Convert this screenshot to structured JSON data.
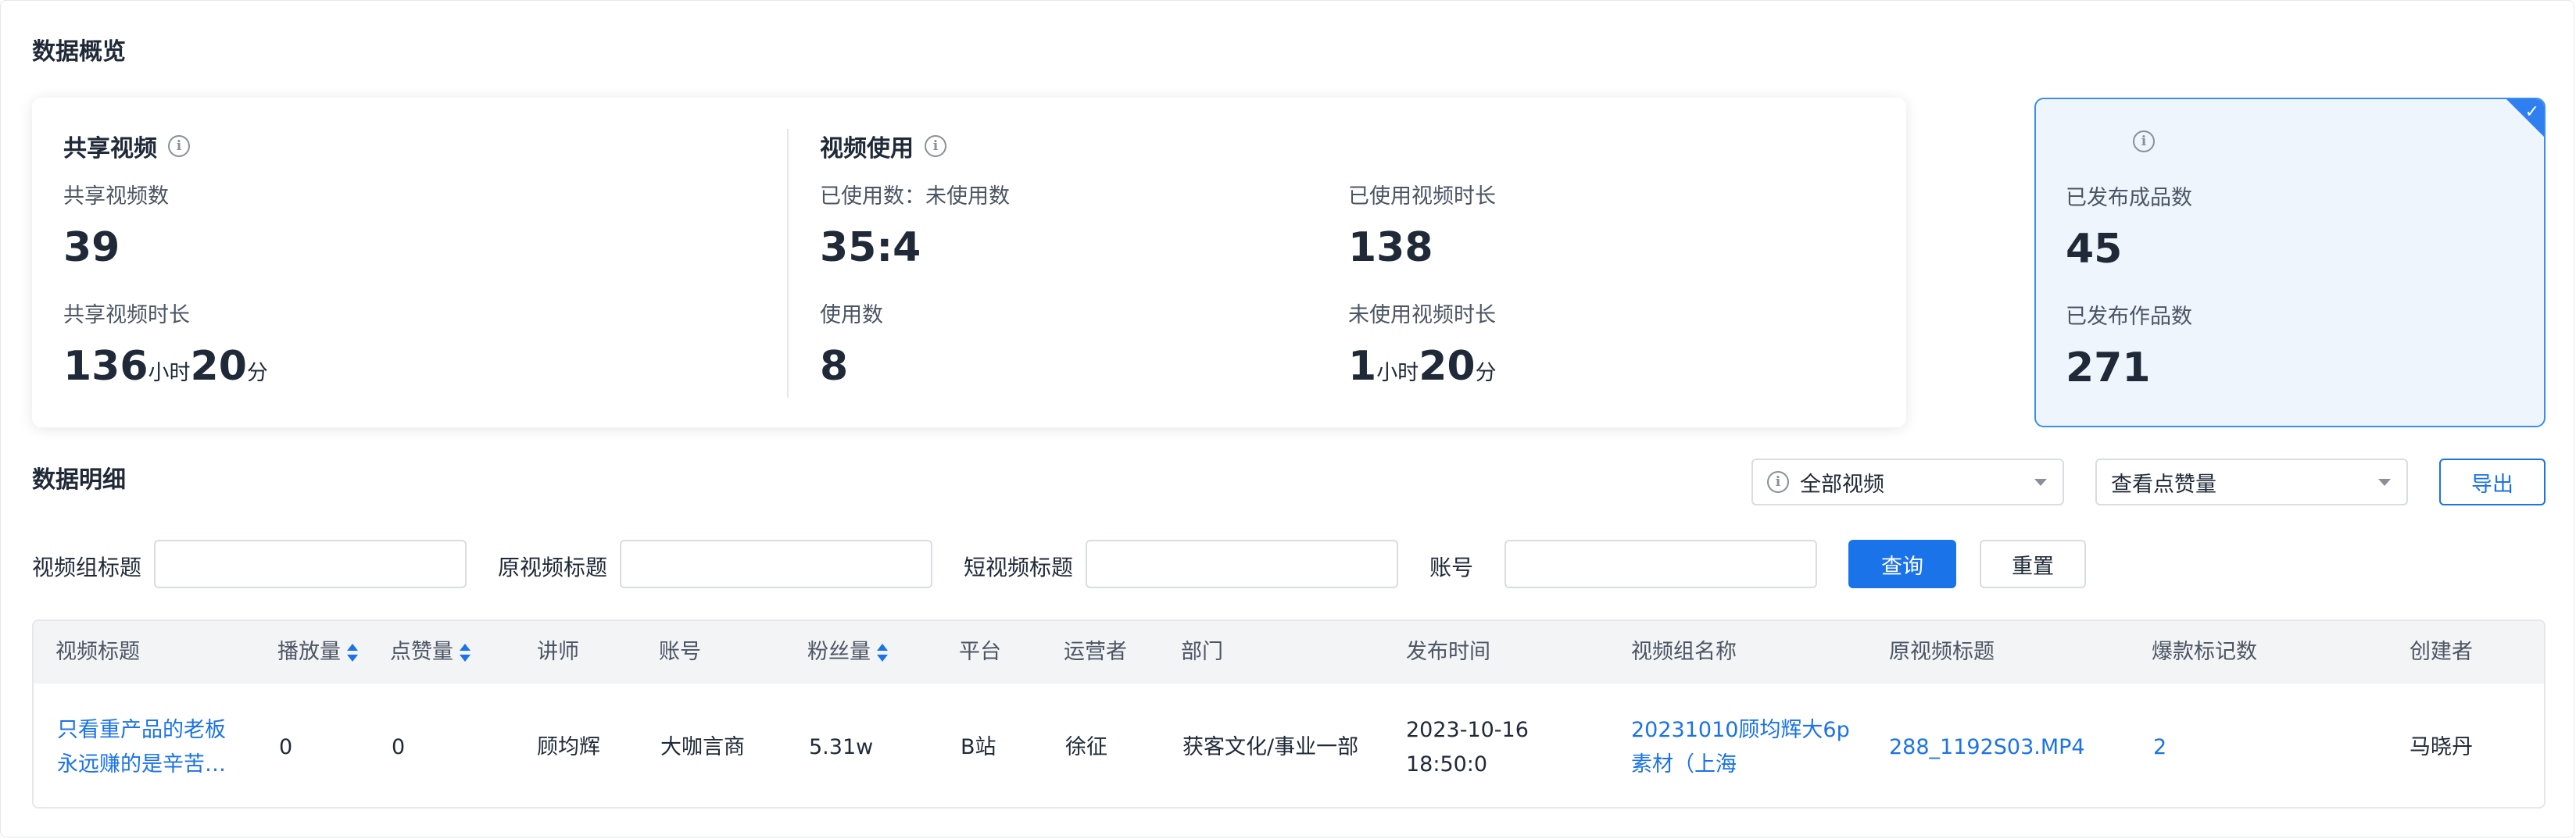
{
  "overview": {
    "title": "数据概览",
    "shared": {
      "title": "共享视频",
      "count_label": "共享视频数",
      "count_value": "39",
      "duration_label": "共享视频时长",
      "duration_hours": "136",
      "hours_unit": "小时",
      "duration_minutes": "20",
      "minutes_unit": "分"
    },
    "usage": {
      "title": "视频使用",
      "ratio_label": "已使用数：未使用数",
      "ratio_value": "35:4",
      "used_count_label": "使用数",
      "used_count_value": "8",
      "used_duration_label": "已使用视频时长",
      "used_duration_value": "138",
      "unused_duration_label": "未使用视频时长",
      "unused_hours": "1",
      "hours_unit": "小时",
      "unused_minutes": "20",
      "minutes_unit": "分"
    },
    "published": {
      "title": "",
      "finished_label": "已发布成品数",
      "finished_value": "45",
      "works_label": "已发布作品数",
      "works_value": "271"
    }
  },
  "detail": {
    "title": "数据明细",
    "video_filter": "全部视频",
    "metric_select": "查看点赞量",
    "export_label": "导出",
    "filters": {
      "group_title_label": "视频组标题",
      "original_title_label": "原视频标题",
      "short_title_label": "短视频标题",
      "account_label": "账号",
      "query_label": "查询",
      "reset_label": "重置"
    },
    "columns": [
      "视频标题",
      "播放量",
      "点赞量",
      "讲师",
      "账号",
      "粉丝量",
      "平台",
      "运营者",
      "部门",
      "发布时间",
      "视频组名称",
      "原视频标题",
      "爆款标记数",
      "创建者"
    ],
    "rows": [
      {
        "title_line1": "只看重产品的老板",
        "title_line2": "永远赚的是辛苦…",
        "plays": "0",
        "likes": "0",
        "lecturer": "顾均辉",
        "account": "大咖言商",
        "fans": "5.31w",
        "platform": "B站",
        "operator": "徐征",
        "department": "获客文化/事业一部",
        "publish_date": "2023-10-16",
        "publish_time": "18:50:0",
        "group_line1": "20231010顾均辉大6p",
        "group_line2": "素材（上海",
        "original_title": "288_1192S03.MP4",
        "hot_marks": "2",
        "creator": "马晓丹"
      }
    ]
  },
  "icons": [
    "info-icon",
    "check-icon",
    "caret-down-icon",
    "sort-icon"
  ],
  "colors": {
    "primary": "#1a73e8",
    "selected_card_bg": "#eef5fd",
    "selected_border": "#3b8ef0"
  }
}
